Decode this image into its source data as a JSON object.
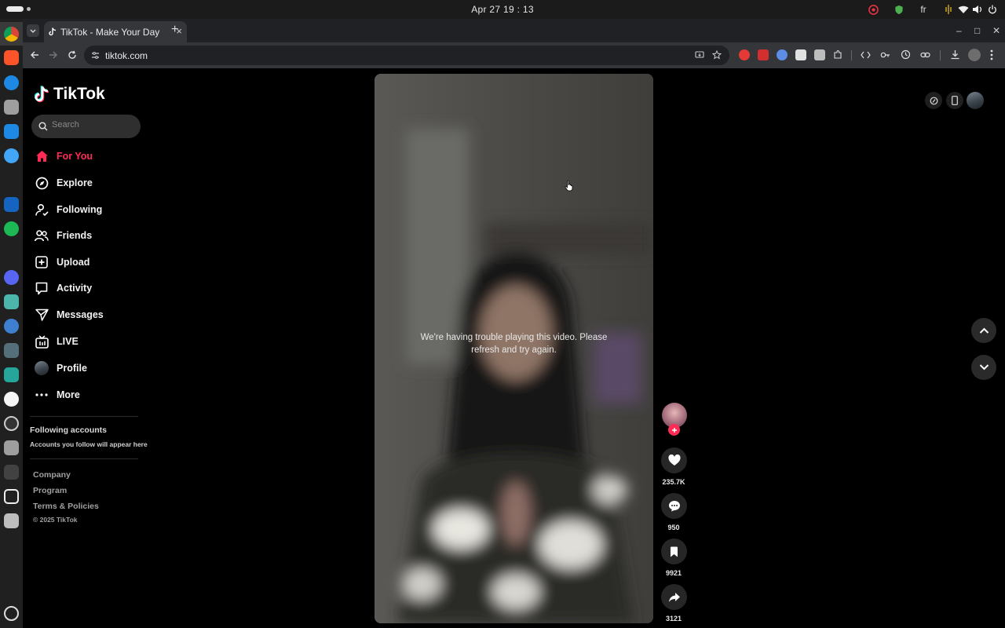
{
  "system": {
    "clock": "Apr 27  19 : 13",
    "keyboard_layout": "fr"
  },
  "browser": {
    "tab_title": "TikTok - Make Your Day",
    "url": "tiktok.com",
    "new_tab_label": "+",
    "close_label": "×",
    "minimize_label": "–",
    "maximize_label": "□",
    "window_close_label": "✕"
  },
  "sidebar": {
    "logo_text": "TikTok",
    "search_placeholder": "Search",
    "nav": [
      {
        "label": "For You",
        "icon": "home-icon",
        "active": true
      },
      {
        "label": "Explore",
        "icon": "compass-icon"
      },
      {
        "label": "Following",
        "icon": "following-icon"
      },
      {
        "label": "Friends",
        "icon": "friends-icon"
      },
      {
        "label": "Upload",
        "icon": "upload-icon"
      },
      {
        "label": "Activity",
        "icon": "activity-icon"
      },
      {
        "label": "Messages",
        "icon": "messages-icon"
      },
      {
        "label": "LIVE",
        "icon": "live-icon"
      },
      {
        "label": "Profile",
        "icon": "profile-avatar"
      },
      {
        "label": "More",
        "icon": "more-icon"
      }
    ],
    "following_title": "Following accounts",
    "following_hint": "Accounts you follow will appear here",
    "footer_links": [
      "Company",
      "Program",
      "Terms & Policies"
    ],
    "copyright": "© 2025 TikTok"
  },
  "video": {
    "error_message": "We're having trouble playing this video. Please refresh and try again."
  },
  "actions": {
    "likes": "235.7K",
    "comments": "950",
    "saves": "9921",
    "shares": "3121"
  },
  "colors": {
    "accent": "#fe2c55",
    "background": "#000000",
    "video_bg": "#4e4d4a"
  }
}
